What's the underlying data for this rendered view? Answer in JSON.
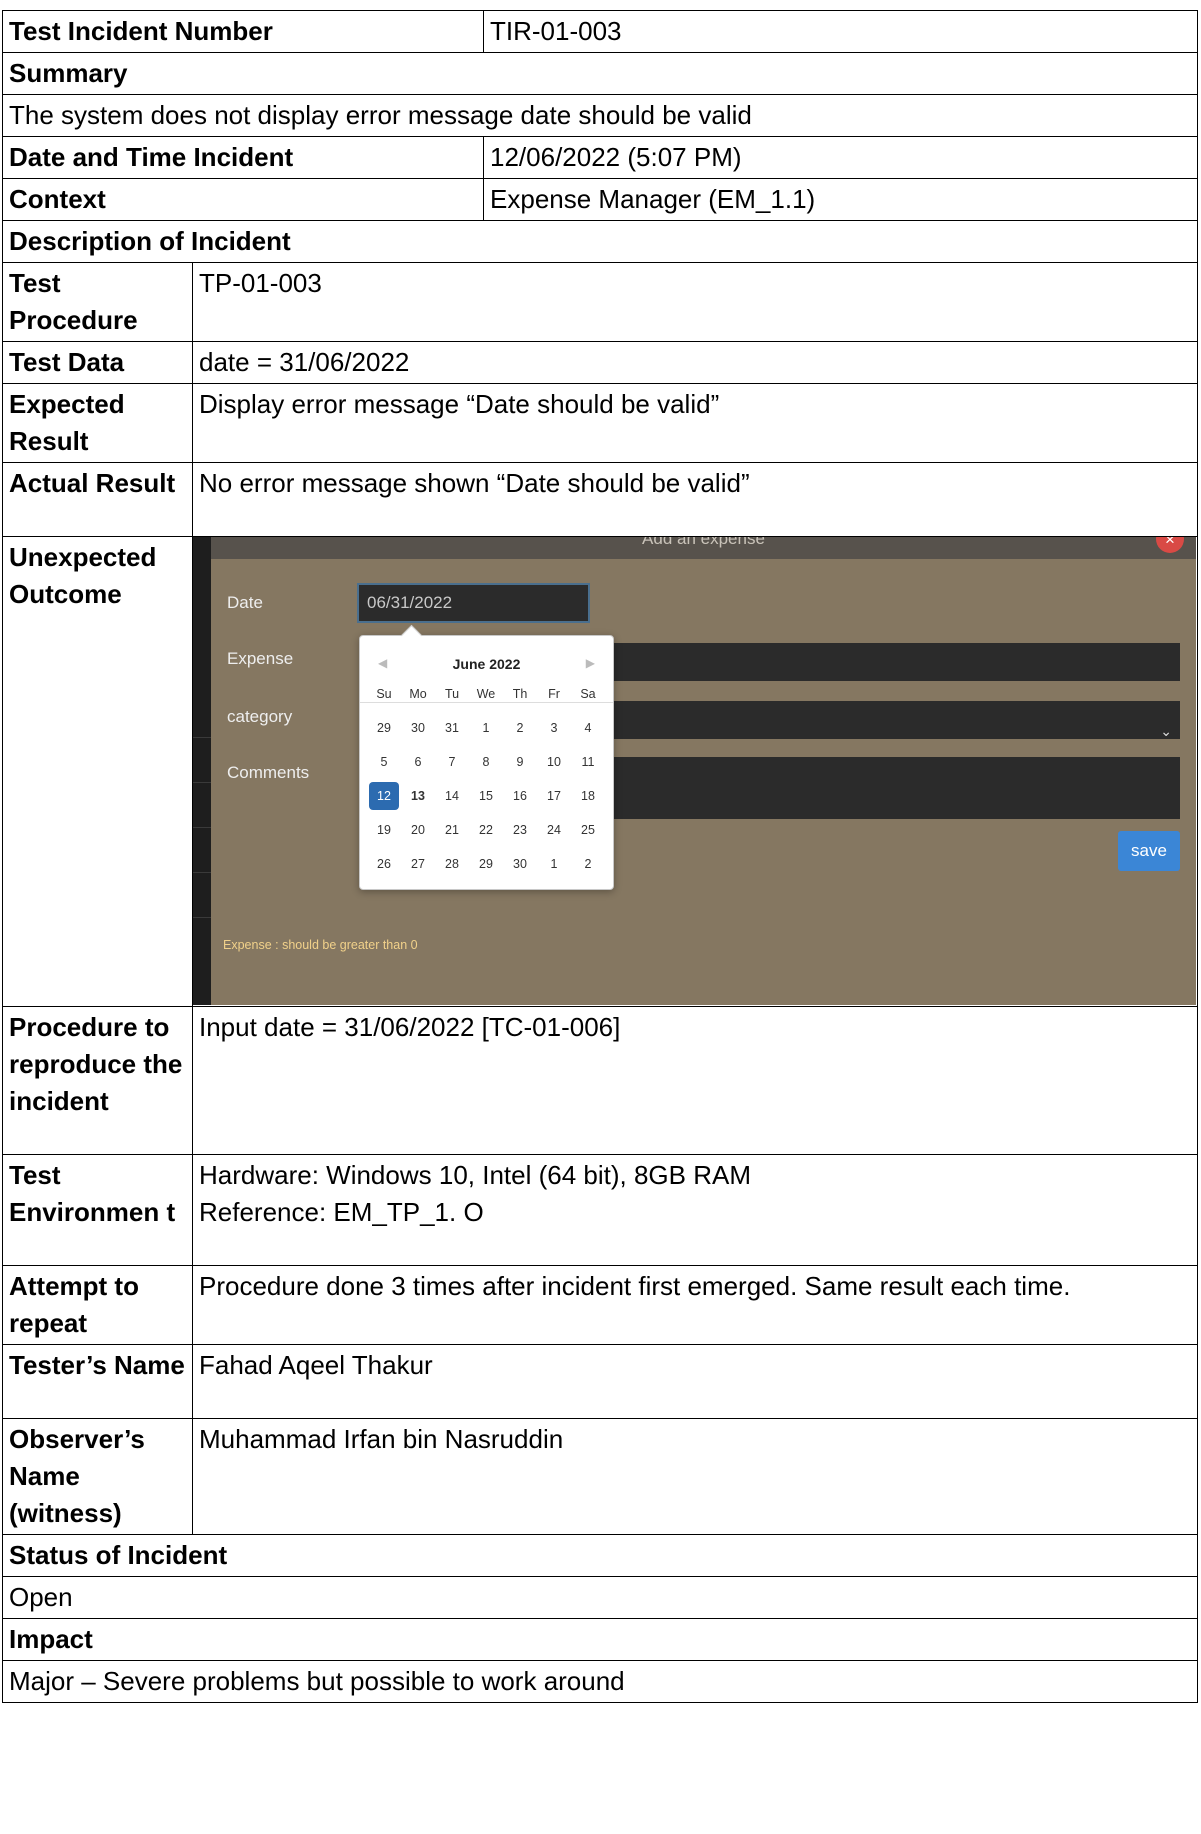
{
  "header": {
    "label": "Test Incident Number",
    "value": "TIR-01-003"
  },
  "summary": {
    "label": "Summary",
    "text": "The system does not display error message date should be valid"
  },
  "date_time": {
    "label": "Date and Time Incident",
    "value": "12/06/2022 (5:07 PM)"
  },
  "context": {
    "label": "Context",
    "value": "Expense Manager (EM_1.1)"
  },
  "description": {
    "label": "Description of Incident"
  },
  "rows": {
    "test_procedure": {
      "label": "Test Procedure",
      "value": "TP-01-003"
    },
    "test_data": {
      "label": "Test Data",
      "value": "date = 31/06/2022"
    },
    "expected": {
      "label": "Expected Result",
      "value": "Display error message “Date should be valid”"
    },
    "actual": {
      "label": "Actual Result",
      "value": "No error message shown “Date should be valid”"
    },
    "unexpected": {
      "label": "Unexpected Outcome"
    },
    "procedure": {
      "label": "Procedure to reproduce the incident",
      "value": "Input date = 31/06/2022 [TC-01-006]"
    },
    "environment": {
      "label": "Test Environmen t",
      "line1": "Hardware: Windows 10, Intel (64 bit), 8GB RAM",
      "line2": "Reference: EM_TP_1. O"
    },
    "attempt": {
      "label": "Attempt to repeat",
      "value": "Procedure done 3 times after incident first emerged. Same result each time."
    },
    "tester": {
      "label": "Tester’s Name",
      "value": "Fahad Aqeel Thakur"
    },
    "observer": {
      "label": "Observer’s Name (witness)",
      "value": "Muhammad Irfan bin Nasruddin"
    }
  },
  "status": {
    "label": "Status of Incident",
    "value": "Open"
  },
  "impact": {
    "label": "Impact",
    "value": "Major – Severe problems but possible to work around"
  },
  "screenshot": {
    "title": "Add an expense",
    "close": "×",
    "date_label": "Date",
    "date_value": "06/31/2022",
    "expense_label": "Expense",
    "category_label": "category",
    "comments_label": "Comments",
    "save": "save",
    "error_text": "Expense : should be greater than 0",
    "calendar": {
      "month": "June 2022",
      "weekdays": [
        "Su",
        "Mo",
        "Tu",
        "We",
        "Th",
        "Fr",
        "Sa"
      ],
      "weeks": [
        [
          "29",
          "30",
          "31",
          "1",
          "2",
          "3",
          "4"
        ],
        [
          "5",
          "6",
          "7",
          "8",
          "9",
          "10",
          "11"
        ],
        [
          "12",
          "13",
          "14",
          "15",
          "16",
          "17",
          "18"
        ],
        [
          "19",
          "20",
          "21",
          "22",
          "23",
          "24",
          "25"
        ],
        [
          "26",
          "27",
          "28",
          "29",
          "30",
          "1",
          "2"
        ]
      ],
      "selected": "12",
      "today": "13"
    }
  }
}
